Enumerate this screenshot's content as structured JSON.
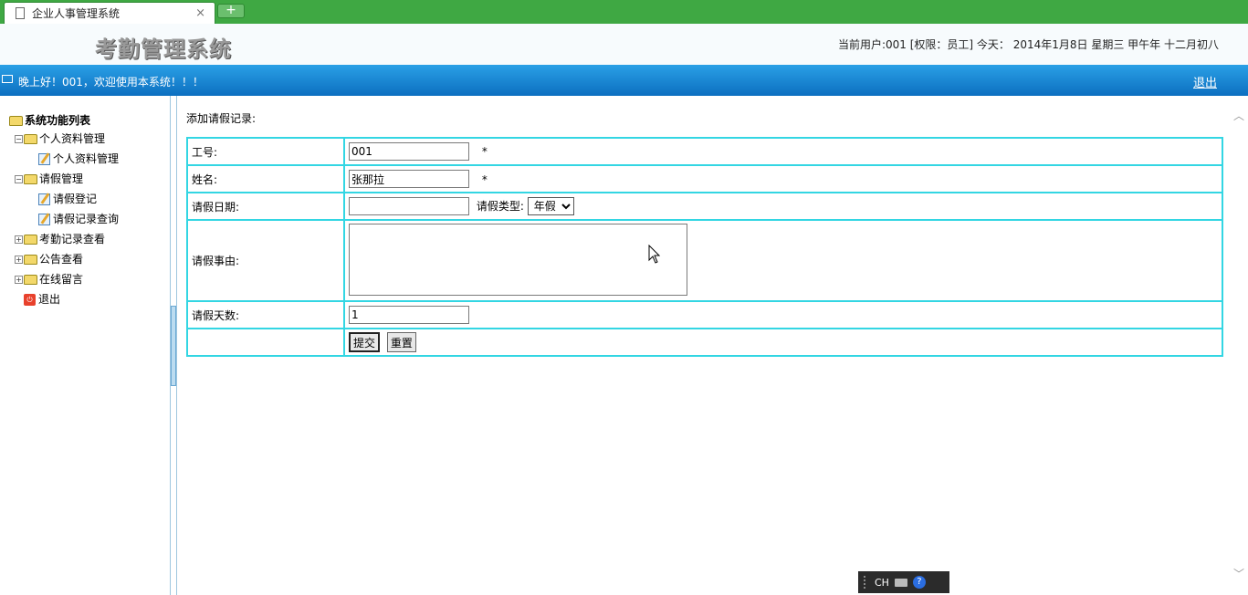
{
  "browser": {
    "tab_title": "企业人事管理系统",
    "close_glyph": "×",
    "newtab_glyph": "+"
  },
  "header": {
    "logo_text": "考勤管理系统",
    "user_info": "当前用户:001 [权限：员工] 今天： 2014年1月8日 星期三 甲午年 十二月初八"
  },
  "bar": {
    "greeting": "晚上好！001，欢迎使用本系统！！！",
    "logout": "退出"
  },
  "sidebar": {
    "root": "系统功能列表",
    "items": [
      {
        "label": "个人资料管理",
        "type": "folder",
        "expander": "−"
      },
      {
        "label": "个人资料管理",
        "type": "leaf"
      },
      {
        "label": "请假管理",
        "type": "folder",
        "expander": "−"
      },
      {
        "label": "请假登记",
        "type": "leaf"
      },
      {
        "label": "请假记录查询",
        "type": "leaf"
      },
      {
        "label": "考勤记录查看",
        "type": "folder",
        "expander": "+"
      },
      {
        "label": "公告查看",
        "type": "folder",
        "expander": "+"
      },
      {
        "label": "在线留言",
        "type": "folder",
        "expander": "+"
      },
      {
        "label": "退出",
        "type": "exit"
      }
    ]
  },
  "form": {
    "heading": "添加请假记录:",
    "employee_id_label": "工号:",
    "employee_id_value": "001",
    "name_label": "姓名:",
    "name_value": "张那拉",
    "required_mark": "*",
    "date_label": "请假日期:",
    "date_value": "",
    "type_label": "请假类型:",
    "type_selected": "年假",
    "reason_label": "请假事由:",
    "reason_value": "",
    "days_label": "请假天数:",
    "days_value": "1",
    "submit_label": "提交",
    "reset_label": "重置"
  },
  "ime": {
    "lang": "CH",
    "help": "?"
  },
  "colors": {
    "tab_strip": "#3fa843",
    "blue_bar": "#1a86d4",
    "table_border": "#33d6e3"
  }
}
